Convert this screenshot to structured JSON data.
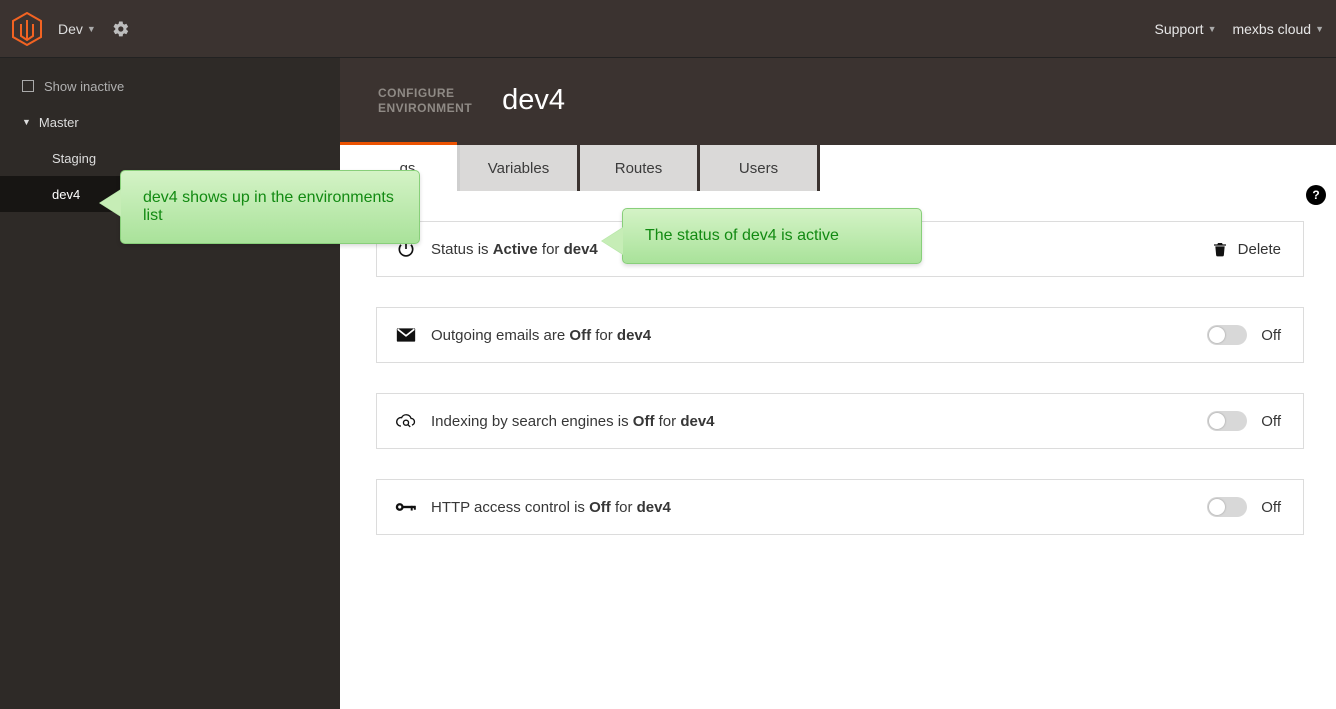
{
  "topbar": {
    "project_label": "Dev",
    "links": {
      "support": "Support",
      "account": "mexbs cloud"
    }
  },
  "sidebar": {
    "show_inactive_label": "Show inactive",
    "env_root": "Master",
    "env_children": [
      "Staging",
      "dev4"
    ],
    "active_env": "dev4"
  },
  "header": {
    "kicker_line": "CONFIGURE ENVIRONMENT",
    "env_name": "dev4"
  },
  "tabs": [
    "Settings",
    "Variables",
    "Routes",
    "Users"
  ],
  "active_tab_index": 0,
  "settings": {
    "status": {
      "prefix": "Status is ",
      "value": "Active",
      "mid": " for ",
      "env": "dev4",
      "delete_label": "Delete"
    },
    "emails": {
      "prefix": "Outgoing emails are ",
      "value": "Off",
      "mid": " for ",
      "env": "dev4",
      "toggle_label": "Off"
    },
    "indexing": {
      "prefix": "Indexing by search engines is ",
      "value": "Off",
      "mid": " for ",
      "env": "dev4",
      "toggle_label": "Off"
    },
    "http_access": {
      "prefix": "HTTP access control is ",
      "value": "Off",
      "mid": " for ",
      "env": "dev4",
      "toggle_label": "Off"
    }
  },
  "callouts": {
    "env_list": "dev4 shows up in the environments list",
    "status": "The status of dev4 is active"
  }
}
